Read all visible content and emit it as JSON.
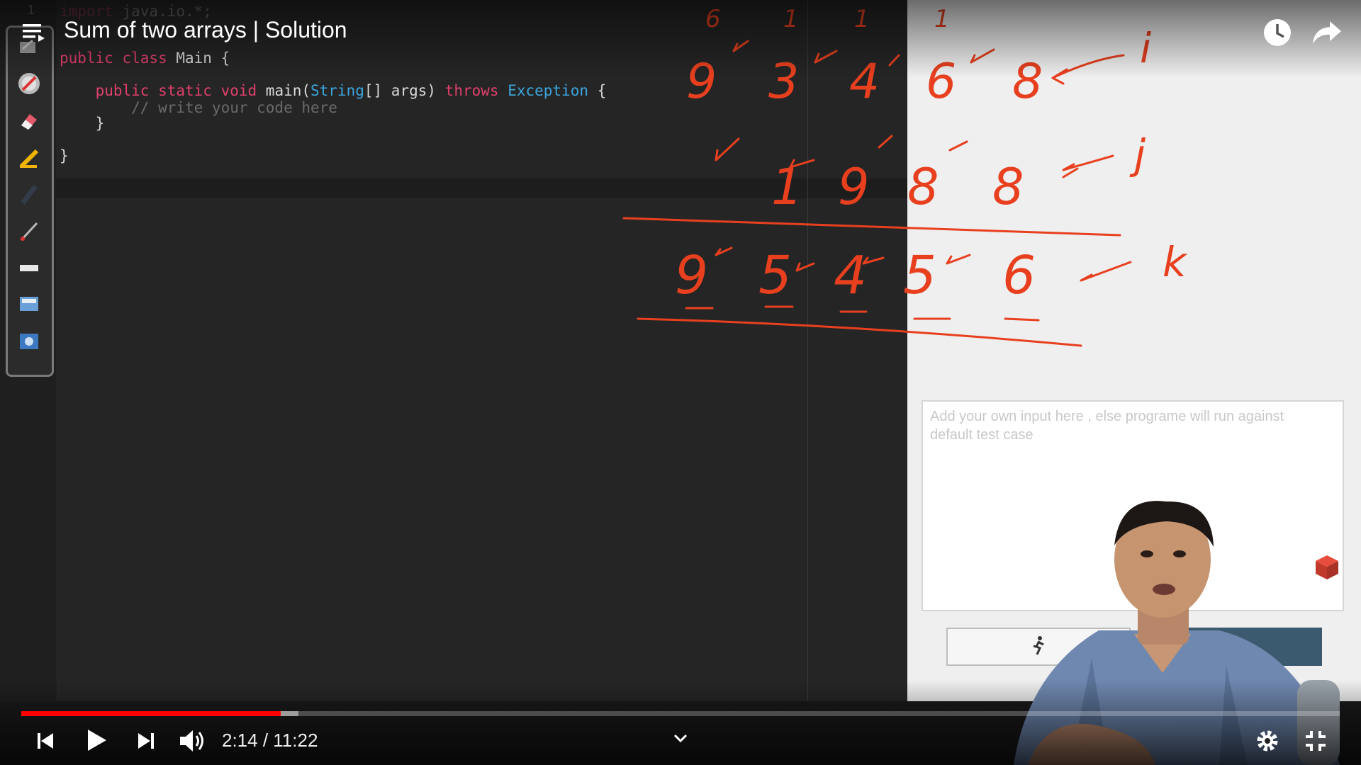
{
  "video": {
    "title": "Sum of two arrays | Solution",
    "current_time": "2:14",
    "separator": " / ",
    "duration": "11:22",
    "played_fraction": 0.1969,
    "buffered_fraction": 0.21
  },
  "editor": {
    "line_number": "1",
    "lines": [
      {
        "parts": [
          {
            "t": "import",
            "c": "kw"
          },
          {
            "t": " java.io.*;",
            "c": ""
          }
        ]
      },
      {
        "parts": [
          {
            "t": "public class",
            "c": "kw"
          },
          {
            "t": " Main {",
            "c": ""
          }
        ]
      },
      {
        "parts": [
          {
            "t": "    public static void",
            "c": "kw"
          },
          {
            "t": " main(",
            "c": ""
          },
          {
            "t": "String",
            "c": "ty"
          },
          {
            "t": "[] args) ",
            "c": ""
          },
          {
            "t": "throws",
            "c": "kw"
          },
          {
            "t": " ",
            "c": ""
          },
          {
            "t": "Exception",
            "c": "ty"
          },
          {
            "t": " {",
            "c": ""
          }
        ]
      },
      {
        "parts": [
          {
            "t": "        // write your code here",
            "c": "cm"
          }
        ]
      },
      {
        "parts": [
          {
            "t": "    }",
            "c": ""
          }
        ]
      },
      {
        "parts": [
          {
            "t": "}",
            "c": ""
          }
        ]
      }
    ]
  },
  "input_panel": {
    "placeholder": "Add your own input here , else programe will run against default test case"
  },
  "handwriting": {
    "top_row": [
      "9",
      "3",
      "4",
      "6",
      "8"
    ],
    "carry_top": [
      "6",
      "1",
      "1",
      "1"
    ],
    "middle_row": [
      "1",
      "9",
      "8",
      "8"
    ],
    "result_row": [
      "9",
      "5",
      "4",
      "5",
      "6"
    ],
    "pointer_labels": [
      "i",
      "j",
      "k"
    ]
  },
  "colors": {
    "ink": "#e8401f",
    "progress_played": "#ff0000"
  },
  "icons": [
    "playlist-icon",
    "watch-later-icon",
    "share-icon",
    "previous-icon",
    "play-icon",
    "next-icon",
    "volume-icon",
    "chevron-down-icon",
    "settings-icon",
    "exit-fullscreen-icon",
    "run-icon"
  ]
}
